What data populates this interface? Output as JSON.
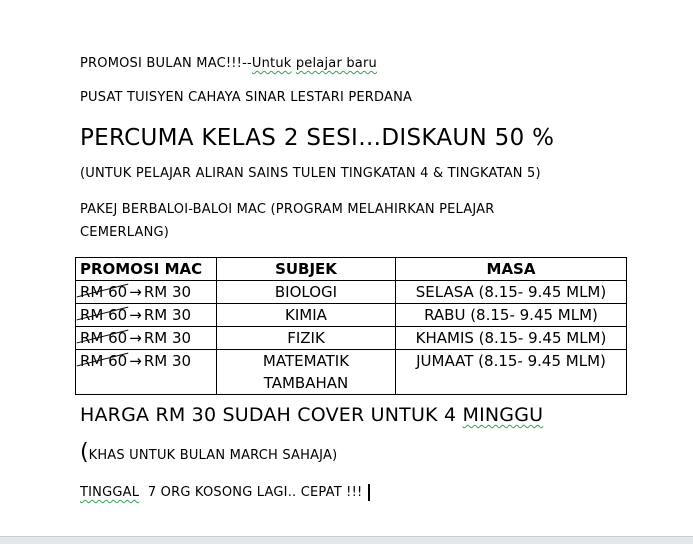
{
  "doc": {
    "line1_prefix": "PROMOSI BULAN MAC!!!--",
    "line1_underlined": "Untuk",
    "line1_suffix": "pelajar baru",
    "line2": "PUSAT TUISYEN CAHAYA SINAR LESTARI PERDANA",
    "line3": "PERCUMA KELAS 2 SESI…DISKAUN 50 %",
    "line4": "(UNTUK PELAJAR ALIRAN SAINS TULEN TINGKATAN 4 & TINGKATAN 5)",
    "line5a": "PAKEJ BERBALOI-BALOI MAC (PROGRAM MELAHIRKAN PELAJAR",
    "line5b": "CEMERLANG)",
    "line6_prefix": "HARGA RM 30 SUDAH COVER UNTUK 4",
    "line6_underlined": "MINGGU",
    "line7_paren": "(",
    "line7_text": "KHAS UNTUK BULAN MARCH SAHAJA)",
    "line8_underlined": "TINGGAL",
    "line8_rest": "7 ORG KOSONG LAGI.. CEPAT !!!"
  },
  "table": {
    "headers": [
      "PROMOSI MAC",
      "SUBJEK",
      "MASA"
    ],
    "rows": [
      {
        "old_price": "RM 60",
        "arrow": "→",
        "new_price": "RM 30",
        "subject_line1": "BIOLOGI",
        "subject_line2": "",
        "time": "SELASA  (8.15- 9.45 MLM)"
      },
      {
        "old_price": "RM 60",
        "arrow": "→",
        "new_price": "RM 30",
        "subject_line1": "KIMIA",
        "subject_line2": "",
        "time": "RABU  (8.15- 9.45 MLM)"
      },
      {
        "old_price": "RM 60",
        "arrow": "→",
        "new_price": "RM 30",
        "subject_line1": "FIZIK",
        "subject_line2": "",
        "time": "KHAMIS (8.15- 9.45 MLM)"
      },
      {
        "old_price": "RM 60",
        "arrow": "→",
        "new_price": "RM 30",
        "subject_line1": "MATEMATIK",
        "subject_line2": "TAMBAHAN",
        "time": "JUMAAT (8.15- 9.45 MLM)"
      }
    ]
  },
  "colors": {
    "spellcheck": "#3aa05a",
    "statusbar": "#e3e6ea"
  }
}
